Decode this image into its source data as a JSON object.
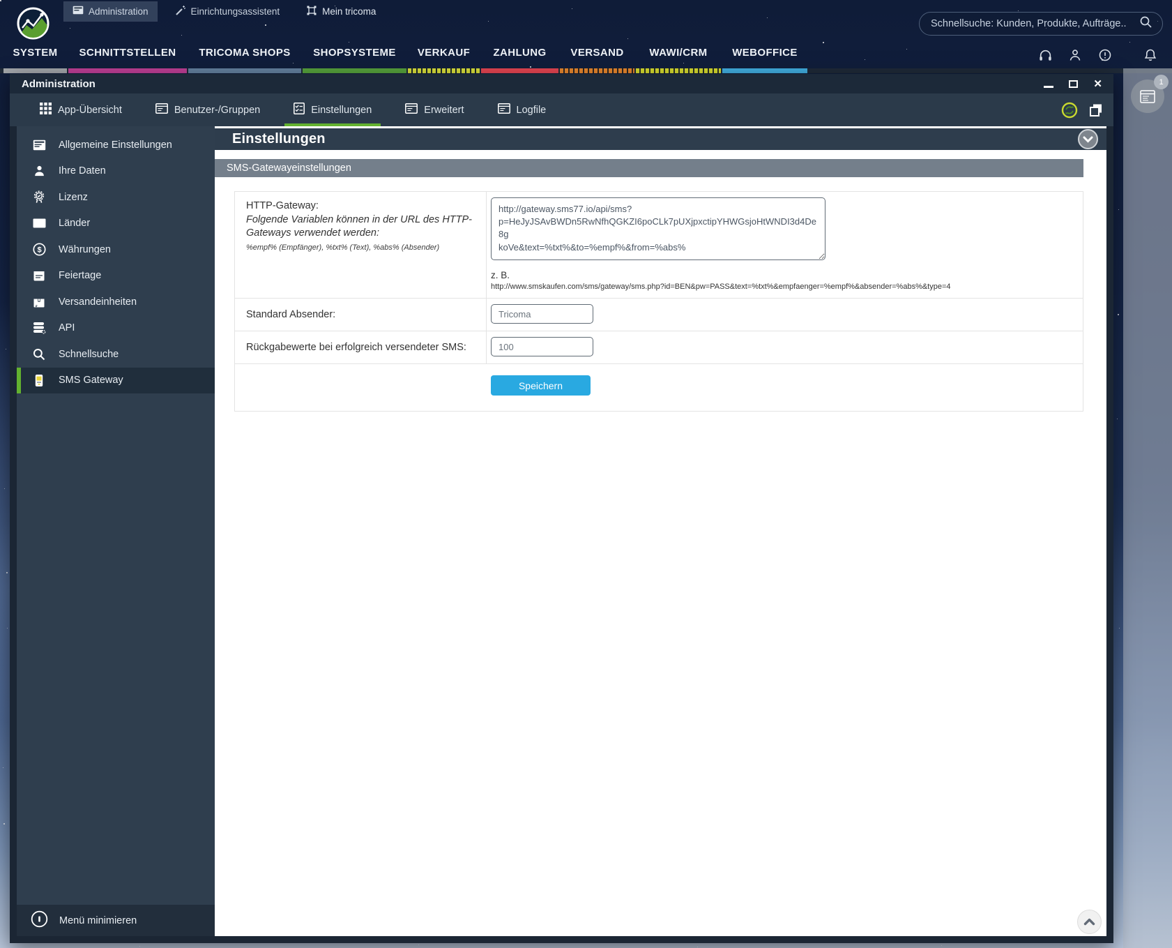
{
  "desktop": {
    "taskbar": [
      {
        "label": "Administration",
        "icon": "window-icon",
        "active": true
      },
      {
        "label": "Einrichtungsassistent",
        "icon": "wand-icon",
        "active": false
      },
      {
        "label": "Mein tricoma",
        "icon": "module-icon",
        "active": false
      }
    ],
    "search": {
      "placeholder": "Schnellsuche: Kunden, Produkte, Aufträge.."
    },
    "nav": {
      "items": [
        {
          "label": "SYSTEM",
          "underline_color": "#a3a7ab"
        },
        {
          "label": "SCHNITTSTELLEN",
          "underline_color": "#bf3f96"
        },
        {
          "label": "TRICOMA SHOPS",
          "underline_color": "#64819f"
        },
        {
          "label": "SHOPSYSTEME",
          "underline_color": "#56a23c"
        },
        {
          "label": "VERKAUF",
          "underline_color": "#d9df3b"
        },
        {
          "label": "ZAHLUNG",
          "underline_color": "#e54552"
        },
        {
          "label": "VERSAND",
          "underline_color": "#e8872e"
        },
        {
          "label": "WAWI/CRM",
          "underline_color": "#d6da2f"
        },
        {
          "label": "WEBOFFICE",
          "underline_color": "#41aee0"
        }
      ]
    },
    "utility_icons": [
      "headset-icon",
      "user-icon",
      "alert-circle-icon",
      "bell-icon"
    ],
    "dock": {
      "badge_count": "1"
    }
  },
  "window": {
    "title": "Administration",
    "tabs": [
      {
        "label": "App-Übersicht",
        "icon": "grid-icon",
        "active": false
      },
      {
        "label": "Benutzer-/Gruppen",
        "icon": "window-icon",
        "active": false
      },
      {
        "label": "Einstellungen",
        "icon": "checklist-icon",
        "active": true
      },
      {
        "label": "Erweitert",
        "icon": "window-icon",
        "active": false
      },
      {
        "label": "Logfile",
        "icon": "window-icon",
        "active": false
      }
    ],
    "sidebar": {
      "items": [
        {
          "label": "Allgemeine Einstellungen",
          "icon": "document-icon",
          "active": false
        },
        {
          "label": "Ihre Daten",
          "icon": "person-icon",
          "active": false
        },
        {
          "label": "Lizenz",
          "icon": "medal-icon",
          "active": false
        },
        {
          "label": "Länder",
          "icon": "flag-icon",
          "active": false
        },
        {
          "label": "Währungen",
          "icon": "currency-icon",
          "active": false
        },
        {
          "label": "Feiertage",
          "icon": "calendar-icon",
          "active": false
        },
        {
          "label": "Versandeinheiten",
          "icon": "package-icon",
          "active": false
        },
        {
          "label": "API",
          "icon": "database-icon",
          "active": false
        },
        {
          "label": "Schnellsuche",
          "icon": "search-icon",
          "active": false
        },
        {
          "label": "SMS Gateway",
          "icon": "phone-icon",
          "active": true
        }
      ],
      "footer_label": "Menü minimieren"
    },
    "content": {
      "heading": "Einstellungen",
      "section_title": "SMS-Gatewayeinstellungen",
      "form": {
        "http_gateway": {
          "label": "HTTP-Gateway:",
          "hint_italic": "Folgende Variablen können in der URL des HTTP-Gateways verwendet werden:",
          "hint_small": "%empf% (Empfänger), %txt% (Text), %abs% (Absender)",
          "value": "http://gateway.sms77.io/api/sms?\np=HeJyJSAvBWDn5RwNfhQGKZI6poCLk7pUXjpxctipYHWGsjoHtWNDI3d4De8g\nkoVe&text=%txt%&to=%empf%&from=%abs%",
          "example_label": "z. B.",
          "example_url": "http://www.smskaufen.com/sms/gateway/sms.php?id=BEN&pw=PASS&text=%txt%&empfaenger=%empf%&absender=%abs%&type=4"
        },
        "standard_absender": {
          "label": "Standard Absender:",
          "value": "Tricoma"
        },
        "rueckgabewerte": {
          "label": "Rückgabewerte bei erfolgreich versendeter SMS:",
          "value": "100"
        },
        "save_label": "Speichern"
      }
    },
    "colors": {
      "accent_green": "#63b22f",
      "save_button_blue": "#29a9e1",
      "heading_band": "#2e3d4d",
      "section_band": "#747f8b",
      "sidebar_bg": "#2f3e4e",
      "titlebar_bg": "#1c2939",
      "tabbar_bg": "#2b3a4a"
    }
  }
}
